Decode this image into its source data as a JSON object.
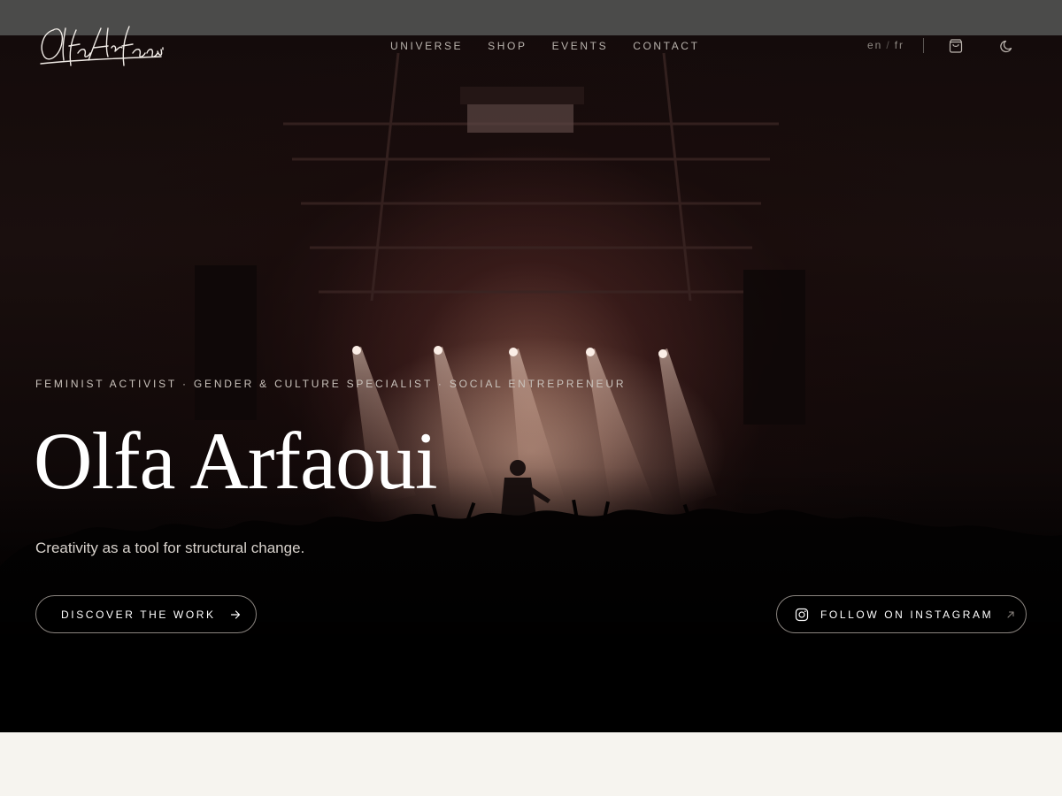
{
  "brand": {
    "logo_text": "Olfa Arfaoui"
  },
  "nav": {
    "items": [
      "UNIVERSE",
      "SHOP",
      "EVENTS",
      "CONTACT"
    ]
  },
  "language": {
    "en": "en",
    "separator": "/",
    "fr": "fr"
  },
  "header_icons": [
    "shopping-bag-icon",
    "moon-icon"
  ],
  "hero": {
    "tagline": "FEMINIST ACTIVIST · GENDER & CULTURE SPECIALIST · SOCIAL ENTREPRENEUR",
    "title": "Olfa Arfaoui",
    "subtitle": "Creativity as a tool for structural change.",
    "primary_button": "DISCOVER THE WORK",
    "secondary_button": "FOLLOW ON INSTAGRAM"
  },
  "colors": {
    "top_bar": "#4b4b4a",
    "hero_background": "#000000",
    "page_background": "#f6f4ef",
    "text_light": "#ffffff"
  }
}
